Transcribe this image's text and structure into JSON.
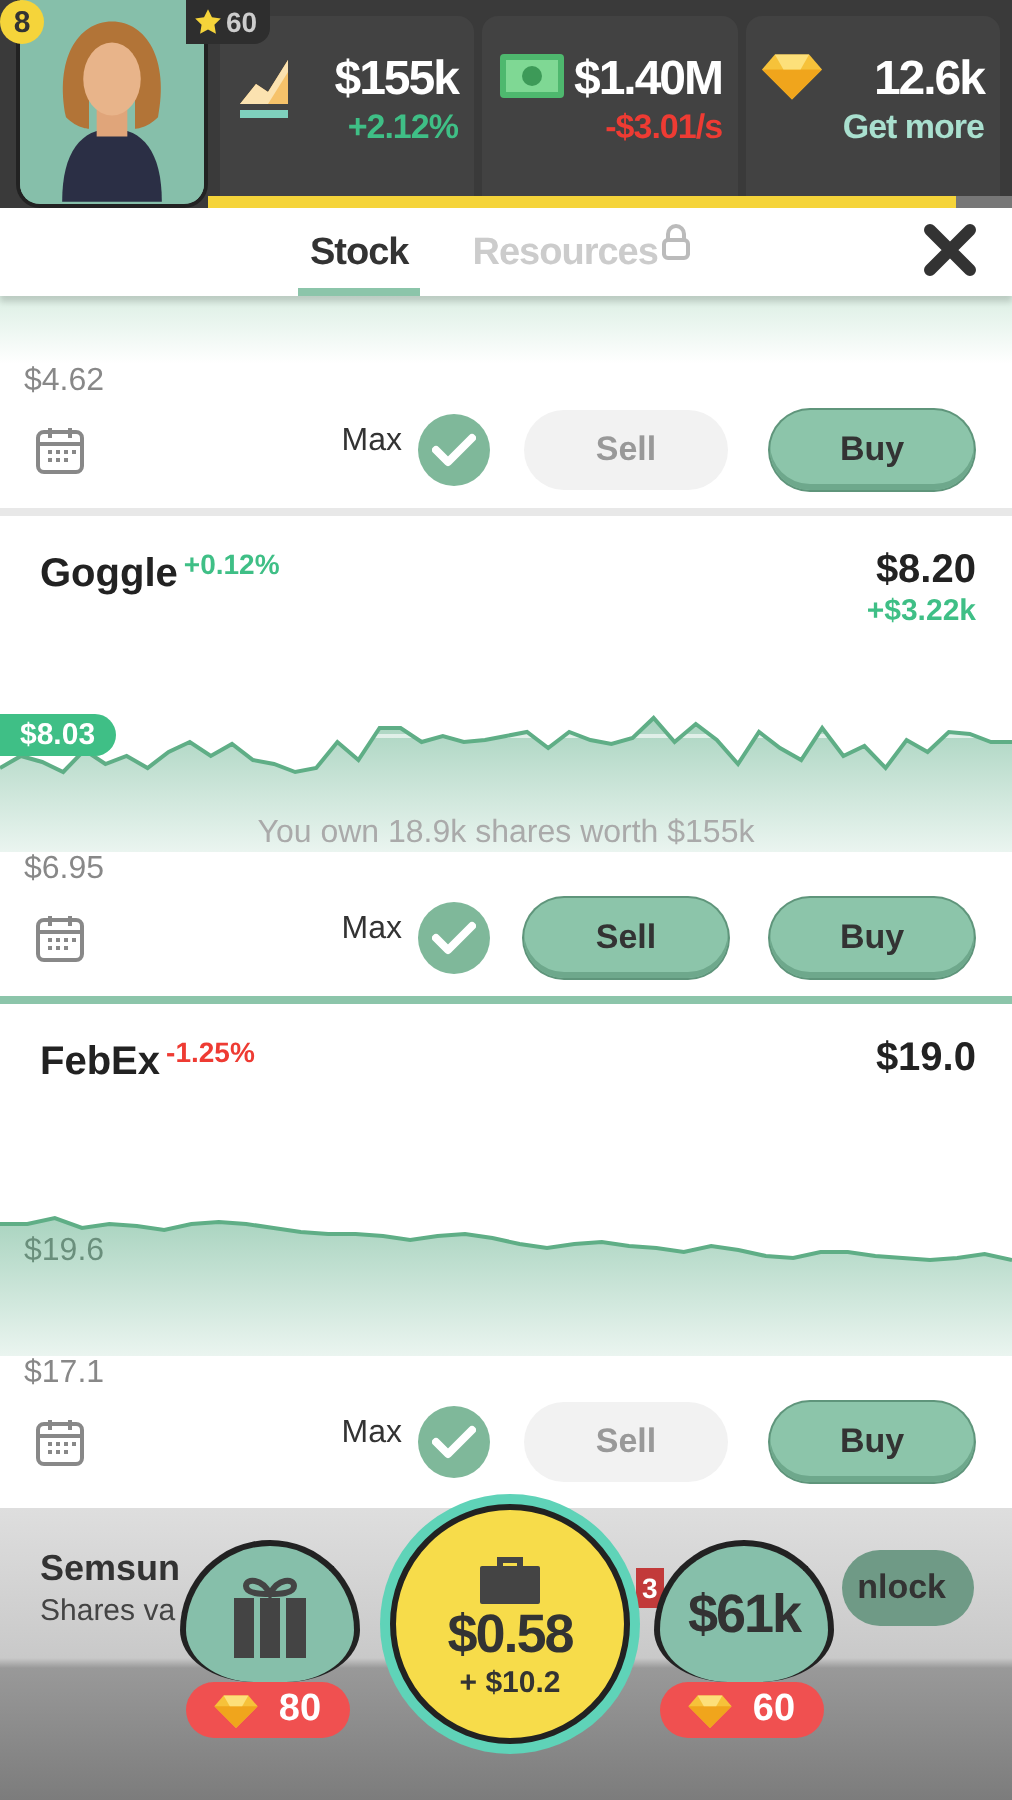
{
  "header": {
    "level": "8",
    "stars": "60",
    "xp": {
      "level": 0.93
    },
    "stats": [
      {
        "kind": "portfolio",
        "value": "$155k",
        "detail": "+2.12%",
        "negative": false
      },
      {
        "kind": "cash",
        "value": "$1.40M",
        "detail": "-$3.01/s",
        "negative": true
      },
      {
        "kind": "gems",
        "value": "12.6k",
        "detail": "Get more"
      }
    ]
  },
  "tabs": [
    {
      "label": "Stock",
      "selected": true,
      "locked": false
    },
    {
      "label": "Resources",
      "selected": false,
      "locked": true
    }
  ],
  "stocks": [
    {
      "kind": "fade",
      "low": "$4.62",
      "max_label": "Max",
      "max_checked": true,
      "sell_label": "Sell",
      "sell_enabled": false,
      "buy_label": "Buy"
    },
    {
      "name": "Goggle",
      "change": "+0.12%",
      "negative": false,
      "price": "$8.20",
      "gain": "+$3.22k",
      "kind": "volatile",
      "chart_label": {
        "text": "$8.03",
        "kind": "tag"
      },
      "owned": "You own 18.9k shares worth $155k",
      "low": "$6.95",
      "max_label": "Max",
      "max_checked": true,
      "sell_label": "Sell",
      "sell_enabled": true,
      "buy_label": "Buy"
    },
    {
      "name": "FebEx",
      "change": "-1.25%",
      "negative": true,
      "price": "$19.0",
      "kind": "steady",
      "chart_label": {
        "text": "$19.6",
        "kind": "plain"
      },
      "low": "$17.1",
      "max_label": "Max",
      "max_checked": true,
      "sell_label": "Sell",
      "sell_enabled": false,
      "buy_label": "Buy"
    }
  ],
  "locked_stock": {
    "name": "Semsun",
    "subtitle": "Shares va",
    "badge": "3",
    "button": "nlock"
  },
  "dock": [
    {
      "kind": "gift",
      "price": "80"
    },
    {
      "kind": "collect",
      "value": "$0.58",
      "income": "+ $10.2"
    },
    {
      "kind": "worth",
      "value": "$61k",
      "price": "60"
    }
  ]
}
